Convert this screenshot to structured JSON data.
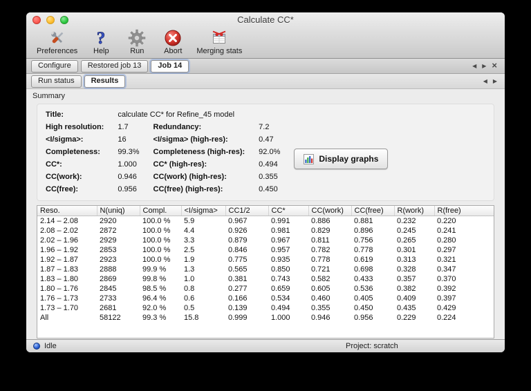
{
  "window": {
    "title": "Calculate CC*"
  },
  "toolbar": {
    "items": [
      {
        "label": "Preferences"
      },
      {
        "label": "Help"
      },
      {
        "label": "Run"
      },
      {
        "label": "Abort"
      },
      {
        "label": "Merging stats"
      }
    ]
  },
  "icons": {
    "scroll_left": "◀",
    "scroll_right": "▶",
    "close_tab": "×"
  },
  "job_tabs": [
    {
      "label": "Configure",
      "selected": false
    },
    {
      "label": "Restored job 13",
      "selected": false
    },
    {
      "label": "Job 14",
      "selected": true
    }
  ],
  "sub_tabs": [
    {
      "label": "Run status",
      "selected": false
    },
    {
      "label": "Results",
      "selected": true
    }
  ],
  "summary": {
    "section_label": "Summary",
    "title_label": "Title:",
    "title_value": "calculate CC* for Refine_45 model",
    "stats": [
      [
        "High resolution:",
        "1.7",
        "Redundancy:",
        "7.2"
      ],
      [
        "<I/sigma>:",
        "16",
        "<I/sigma> (high-res):",
        "0.47"
      ],
      [
        "Completeness:",
        "99.3%",
        "Completeness (high-res):",
        "92.0%"
      ],
      [
        "CC*:",
        "1.000",
        "CC* (high-res):",
        "0.494"
      ],
      [
        "CC(work):",
        "0.946",
        "CC(work) (high-res):",
        "0.355"
      ],
      [
        "CC(free):",
        "0.956",
        "CC(free) (high-res):",
        "0.450"
      ]
    ],
    "display_graphs_label": "Display graphs"
  },
  "table": {
    "columns": [
      "Reso.",
      "N(uniq)",
      "Compl.",
      "<I/sigma>",
      "CC1/2",
      "CC*",
      "CC(work)",
      "CC(free)",
      "R(work)",
      "R(free)"
    ],
    "rows": [
      [
        "2.14 – 2.08",
        "2920",
        "100.0 %",
        "5.9",
        "0.967",
        "0.991",
        "0.886",
        "0.881",
        "0.232",
        "0.220"
      ],
      [
        "2.08 – 2.02",
        "2872",
        "100.0 %",
        "4.4",
        "0.926",
        "0.981",
        "0.829",
        "0.896",
        "0.245",
        "0.241"
      ],
      [
        "2.02 – 1.96",
        "2929",
        "100.0 %",
        "3.3",
        "0.879",
        "0.967",
        "0.811",
        "0.756",
        "0.265",
        "0.280"
      ],
      [
        "1.96 – 1.92",
        "2853",
        "100.0 %",
        "2.5",
        "0.846",
        "0.957",
        "0.782",
        "0.778",
        "0.301",
        "0.297"
      ],
      [
        "1.92 – 1.87",
        "2923",
        "100.0 %",
        "1.9",
        "0.775",
        "0.935",
        "0.778",
        "0.619",
        "0.313",
        "0.321"
      ],
      [
        "1.87 – 1.83",
        "2888",
        "99.9 %",
        "1.3",
        "0.565",
        "0.850",
        "0.721",
        "0.698",
        "0.328",
        "0.347"
      ],
      [
        "1.83 – 1.80",
        "2869",
        "99.8 %",
        "1.0",
        "0.381",
        "0.743",
        "0.582",
        "0.433",
        "0.357",
        "0.370"
      ],
      [
        "1.80 – 1.76",
        "2845",
        "98.5 %",
        "0.8",
        "0.277",
        "0.659",
        "0.605",
        "0.536",
        "0.382",
        "0.392"
      ],
      [
        "1.76 – 1.73",
        "2733",
        "96.4 %",
        "0.6",
        "0.166",
        "0.534",
        "0.460",
        "0.405",
        "0.409",
        "0.397"
      ],
      [
        "1.73 – 1.70",
        "2681",
        "92.0 %",
        "0.5",
        "0.139",
        "0.494",
        "0.355",
        "0.450",
        "0.435",
        "0.429"
      ],
      [
        "All",
        "58122",
        "99.3 %",
        "15.8",
        "0.999",
        "1.000",
        "0.946",
        "0.956",
        "0.229",
        "0.224"
      ]
    ]
  },
  "statusbar": {
    "status": "Idle",
    "project": "Project: scratch"
  },
  "colors": {
    "accent_blue": "#2f62c4",
    "abort_red": "#d93b32",
    "status_dot_blue": "#2d62d6"
  }
}
